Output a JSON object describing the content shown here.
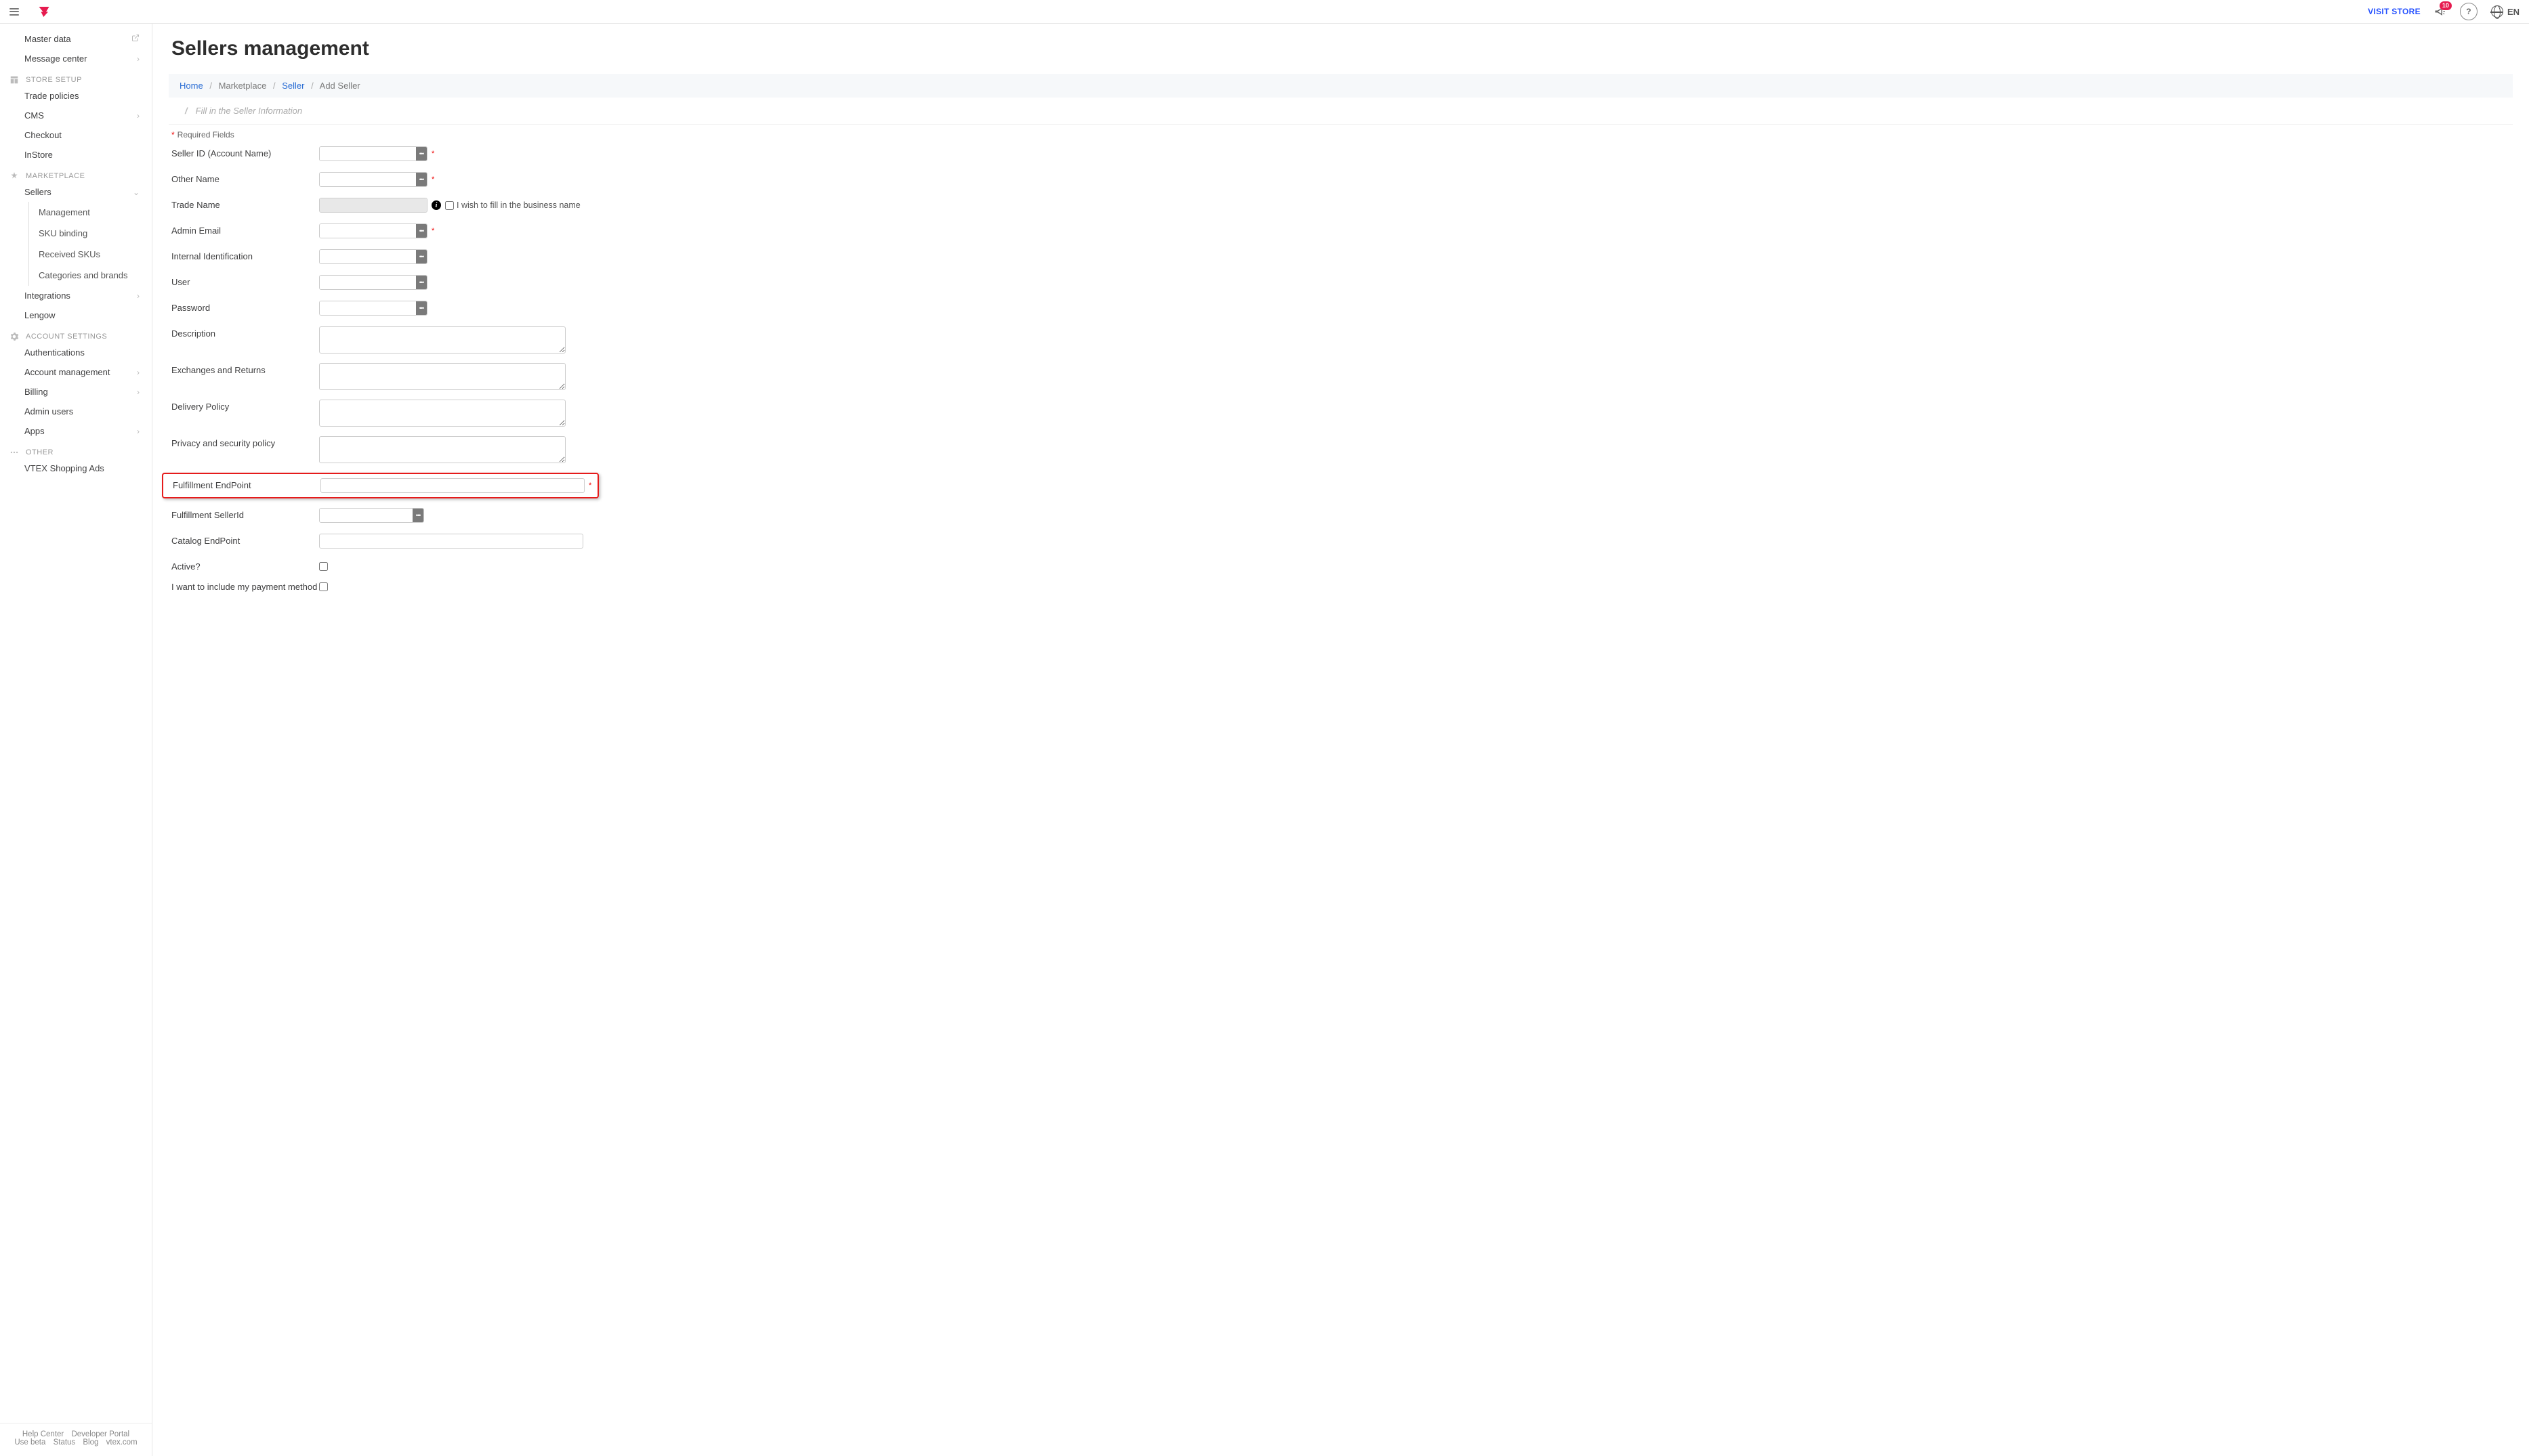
{
  "header": {
    "visit_store": "VISIT STORE",
    "notif_count": "10",
    "language": "EN"
  },
  "sidebar": {
    "nav_master_data": "Master data",
    "nav_message_center": "Message center",
    "section_store_setup": "STORE SETUP",
    "nav_trade_policies": "Trade policies",
    "nav_cms": "CMS",
    "nav_checkout": "Checkout",
    "nav_instore": "InStore",
    "section_marketplace": "MARKETPLACE",
    "nav_sellers": "Sellers",
    "nav_management": "Management",
    "nav_sku_binding": "SKU binding",
    "nav_received_skus": "Received SKUs",
    "nav_categories_brands": "Categories and brands",
    "nav_integrations": "Integrations",
    "nav_lengow": "Lengow",
    "section_account_settings": "ACCOUNT SETTINGS",
    "nav_authentications": "Authentications",
    "nav_account_management": "Account management",
    "nav_billing": "Billing",
    "nav_admin_users": "Admin users",
    "nav_apps": "Apps",
    "section_other": "OTHER",
    "nav_vtex_shopping_ads": "VTEX Shopping Ads",
    "footer_help_center": "Help Center",
    "footer_developer_portal": "Developer Portal",
    "footer_use_beta": "Use beta",
    "footer_status": "Status",
    "footer_blog": "Blog",
    "footer_vtexcom": "vtex.com"
  },
  "main": {
    "page_title": "Sellers management",
    "breadcrumb": {
      "home": "Home",
      "marketplace": "Marketplace",
      "seller": "Seller",
      "add_seller": "Add Seller"
    },
    "form_header": "Fill in the Seller Information",
    "required": "Required Fields",
    "labels": {
      "seller_id": "Seller ID (Account Name)",
      "other_name": "Other Name",
      "trade_name": "Trade Name",
      "trade_name_chk": "I wish to fill in the business name",
      "admin_email": "Admin Email",
      "internal_id": "Internal Identification",
      "user": "User",
      "password": "Password",
      "description": "Description",
      "exchanges_returns": "Exchanges and Returns",
      "delivery_policy": "Delivery Policy",
      "privacy_policy": "Privacy and security policy",
      "fulfillment_endpoint": "Fulfillment EndPoint",
      "fulfillment_seller_id": "Fulfillment SellerId",
      "catalog_endpoint": "Catalog EndPoint",
      "active": "Active?",
      "payment_method": "I want to include my payment method"
    }
  }
}
